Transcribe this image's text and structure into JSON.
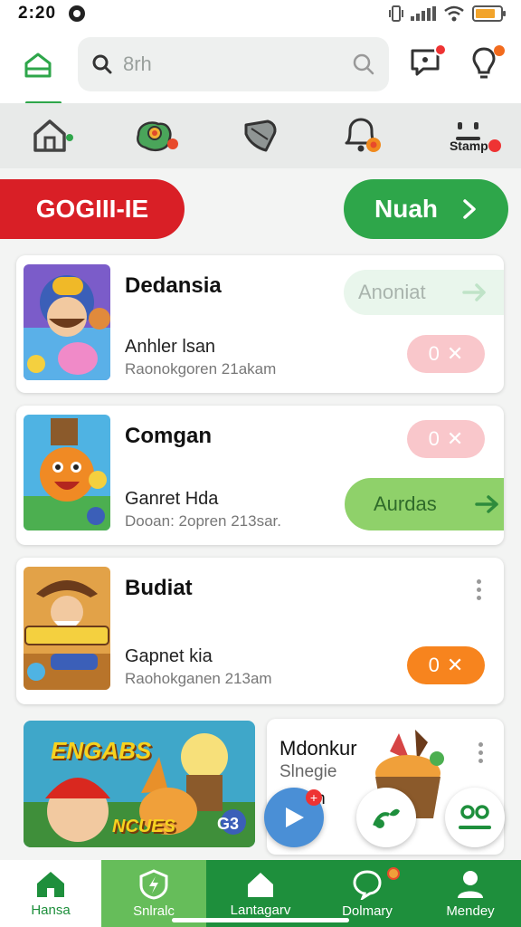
{
  "status_bar": {
    "time": "2:20",
    "battery_level": 0.8
  },
  "header": {
    "search_placeholder": "8rh"
  },
  "categories": [
    {
      "name": "home",
      "label": ""
    },
    {
      "name": "flower",
      "label": ""
    },
    {
      "name": "shell",
      "label": ""
    },
    {
      "name": "bell",
      "label": ""
    },
    {
      "name": "stamp",
      "label": "Stamp"
    }
  ],
  "promo": {
    "left_label": "GOGIII-IE",
    "right_label": "Nuah"
  },
  "cards": [
    {
      "title": "Dedansia",
      "subtitle": "Anhler lsan",
      "meta": "Raonokgoren 21akam",
      "action_label": "Anoniat",
      "x_label": "0"
    },
    {
      "title": "Comgan",
      "subtitle": "Ganret Hda",
      "meta": "Dooan: 2opren 213sar.",
      "action_label": "Aurdas",
      "x_label": "0"
    },
    {
      "title": "Budiat",
      "subtitle": "Gapnet kia",
      "meta": "Raohokganen 213am",
      "x_label": "0"
    }
  ],
  "tile_left": {
    "banner_top": "ENGABS",
    "banner_bottom": "NCUES",
    "badge": "G3"
  },
  "tile_right": {
    "title": "Mdonkur",
    "line2": "Slnegie",
    "line3": "msian"
  },
  "bottom_nav": [
    {
      "label": "Hansa"
    },
    {
      "label": "Snlralc"
    },
    {
      "label": "Lantagarv"
    },
    {
      "label": "Dolmary"
    },
    {
      "label": "Mendey"
    }
  ],
  "colors": {
    "primary_green": "#2ea64a",
    "red": "#d91f26",
    "orange": "#f7841e",
    "pink": "#f9c7cb"
  }
}
